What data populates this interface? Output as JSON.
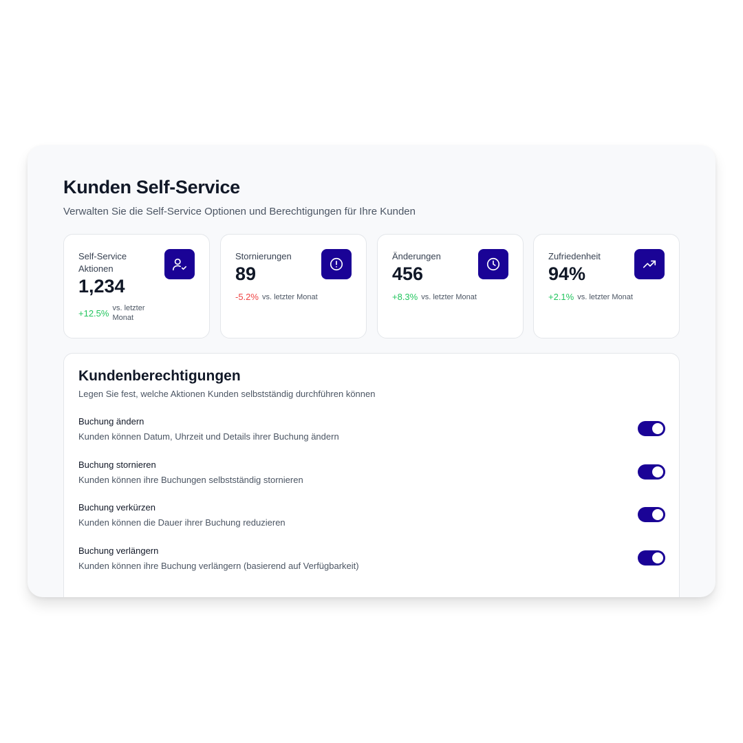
{
  "header": {
    "title": "Kunden Self-Service",
    "subtitle": "Verwalten Sie die Self-Service Optionen und Berechtigungen für Ihre Kunden"
  },
  "stats": [
    {
      "label": "Self-Service Aktionen",
      "value": "1,234",
      "change": "+12.5%",
      "trend": "up",
      "note": "vs. letzter Monat",
      "icon": "user-check-icon"
    },
    {
      "label": "Stornierungen",
      "value": "89",
      "change": "-5.2%",
      "trend": "down",
      "note": "vs. letzter Monat",
      "icon": "alert-circle-icon"
    },
    {
      "label": "Änderungen",
      "value": "456",
      "change": "+8.3%",
      "trend": "up",
      "note": "vs. letzter Monat",
      "icon": "clock-icon"
    },
    {
      "label": "Zufriedenheit",
      "value": "94%",
      "change": "+2.1%",
      "trend": "up",
      "note": "vs. letzter Monat",
      "icon": "trending-up-icon"
    }
  ],
  "permissions": {
    "title": "Kundenberechtigungen",
    "subtitle": "Legen Sie fest, welche Aktionen Kunden selbstständig durchführen können",
    "items": [
      {
        "name": "Buchung ändern",
        "description": "Kunden können Datum, Uhrzeit und Details ihrer Buchung ändern",
        "enabled": true
      },
      {
        "name": "Buchung stornieren",
        "description": "Kunden können ihre Buchungen selbstständig stornieren",
        "enabled": true
      },
      {
        "name": "Buchung verkürzen",
        "description": "Kunden können die Dauer ihrer Buchung reduzieren",
        "enabled": true
      },
      {
        "name": "Buchung verlängern",
        "description": "Kunden können ihre Buchung verlängern (basierend auf Verfügbarkeit)",
        "enabled": true
      }
    ]
  },
  "colors": {
    "accent": "#1a0396",
    "positive": "#22c55e",
    "negative": "#ef4444"
  }
}
